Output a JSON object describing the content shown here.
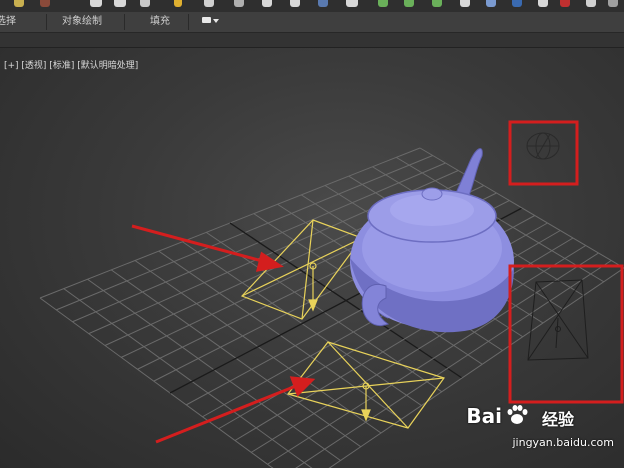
{
  "ribbon": {
    "tabs": [
      {
        "label": "选择"
      },
      {
        "label": "对象绘制"
      },
      {
        "label": "填充"
      }
    ]
  },
  "viewport": {
    "label": "[+] [透视] [标准] [默认明暗处理]"
  },
  "watermark": {
    "brand": "Bai",
    "brand_suffix": "经验",
    "url": "jingyan.baidu.com"
  },
  "colors": {
    "grid": "#6a6a6a",
    "light_gizmo": "#e8d25a",
    "teapot": "#8d8ee0",
    "annotation": "#d41e1e"
  }
}
